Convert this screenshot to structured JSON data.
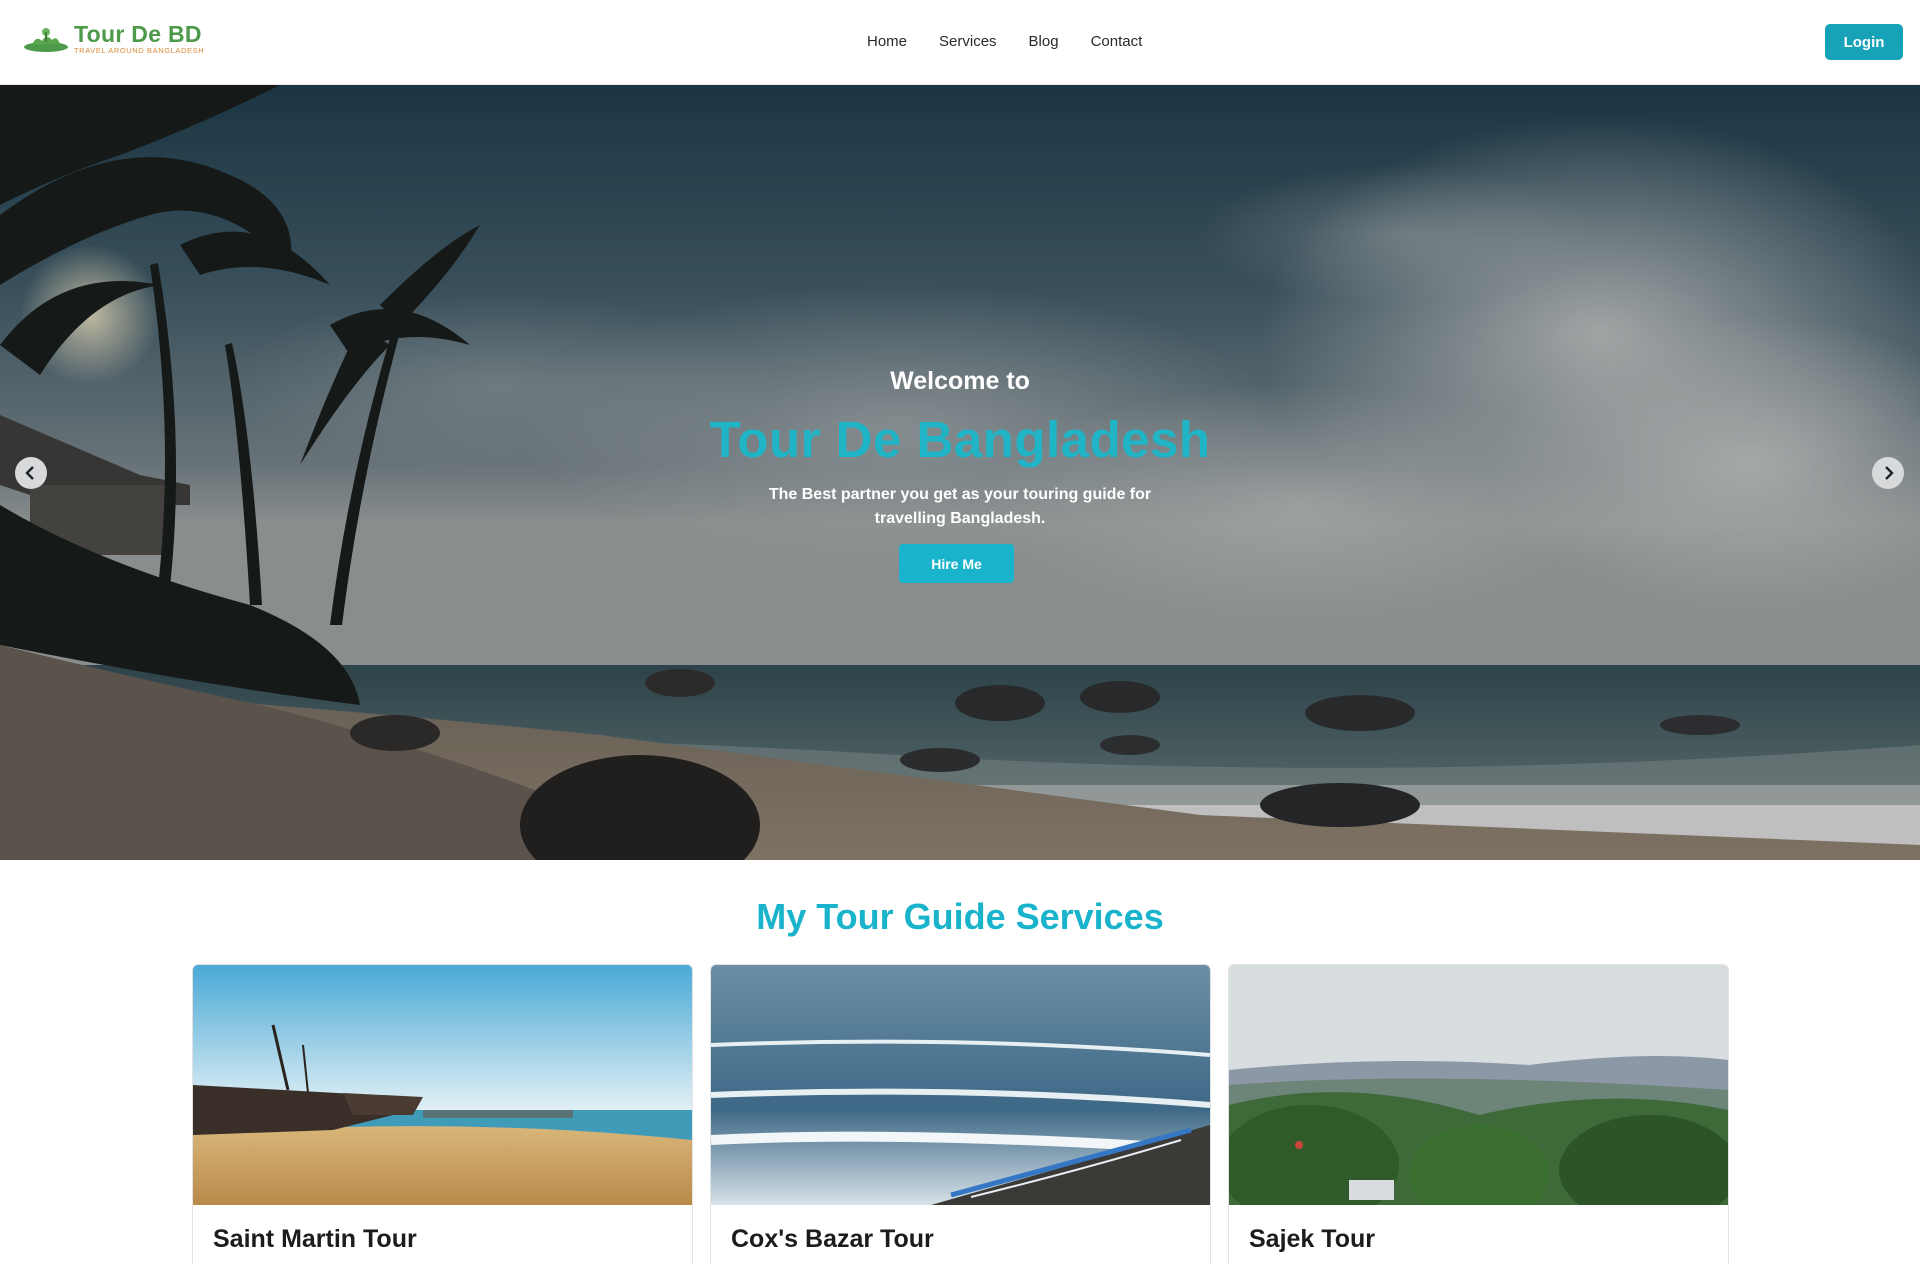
{
  "brand": {
    "name": "Tour De BD",
    "tagline": "TRAVEL AROUND BANGLADESH"
  },
  "nav": {
    "links": [
      "Home",
      "Services",
      "Blog",
      "Contact"
    ],
    "login_label": "Login"
  },
  "hero": {
    "welcome": "Welcome to",
    "title": "Tour De Bangladesh",
    "subtitle": "The Best partner you get as your touring guide for travelling Bangladesh.",
    "cta_label": "Hire Me"
  },
  "services": {
    "heading": "My Tour Guide Services",
    "cards": [
      {
        "title": "Saint Martin Tour"
      },
      {
        "title": "Cox's Bazar Tour"
      },
      {
        "title": "Sajek Tour"
      }
    ]
  },
  "colors": {
    "accent": "#17a2b8",
    "brand_green": "#4c9a4a",
    "brand_orange": "#d68a3a"
  }
}
